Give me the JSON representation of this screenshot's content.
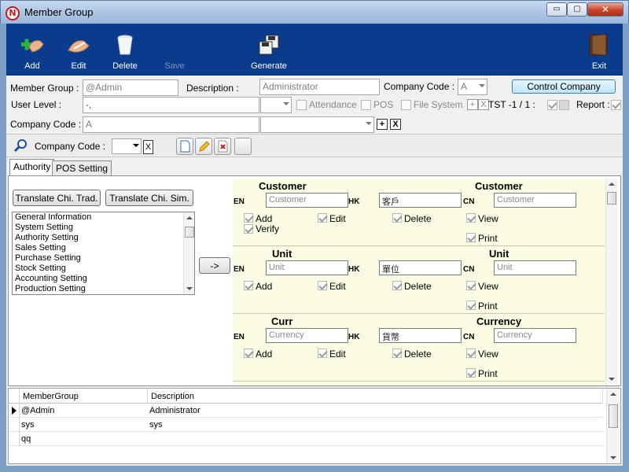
{
  "window": {
    "title": "Member Group",
    "min": "▭",
    "max": "▢",
    "close": "✕"
  },
  "toolbar": {
    "add": "Add",
    "edit": "Edit",
    "delete": "Delete",
    "save": "Save",
    "generate": "Generate",
    "exit": "Exit"
  },
  "form": {
    "member_group_label": "Member Group :",
    "member_group_value": "@Admin",
    "description_label": "Description :",
    "description_value": "Administrator",
    "company_code_label": "Company Code :",
    "company_code_value": "A",
    "control_company_button": "Control Company",
    "user_level_label": "User Level :",
    "user_level_value": "-,",
    "attendance_label": "Attendance",
    "pos_label": "POS",
    "file_system_label": "File System",
    "plus": "+",
    "x": "X",
    "tst_label": "TST -1 / 1 :",
    "report_label": "Report :",
    "company_code2_label": "Company Code :",
    "company_code2_value": "A"
  },
  "search": {
    "company_code_label": "Company Code :",
    "clear": "X"
  },
  "tabs": [
    {
      "label": "Authority"
    },
    {
      "label": "POS Setting"
    }
  ],
  "authority": {
    "translate_trad": "Translate Chi. Trad.",
    "translate_sim": "Translate Chi. Sim.",
    "move_button": "->",
    "settings": [
      "General Information",
      "System Setting",
      "Authority Setting",
      "Sales Setting",
      "Purchase Setting",
      "Stock Setting",
      "Accounting Setting",
      "Production Setting"
    ],
    "sections": [
      {
        "title_left": "Customer",
        "title_right": "Customer",
        "en": "Customer",
        "hk": "客戶",
        "cn": "Customer",
        "perms": [
          "Add",
          "Edit",
          "Delete",
          "View",
          "Verify",
          "Print"
        ]
      },
      {
        "title_left": "Unit",
        "title_right": "Unit",
        "en": "Unit",
        "hk": "單位",
        "cn": "Unit",
        "perms": [
          "Add",
          "Edit",
          "Delete",
          "View",
          "Print"
        ]
      },
      {
        "title_left": "Curr",
        "title_right": "Currency",
        "en": "Currency",
        "hk": "貨幣",
        "cn": "Currency",
        "perms": [
          "Add",
          "Edit",
          "Delete",
          "View",
          "Print"
        ]
      }
    ],
    "lang_en": "EN",
    "lang_hk": "HK",
    "lang_cn": "CN"
  },
  "grid": {
    "columns": [
      "MemberGroup",
      "Description"
    ],
    "rows": [
      {
        "group": "@Admin",
        "description": "Administrator"
      },
      {
        "group": "sys",
        "description": "sys"
      },
      {
        "group": "qq",
        "description": ""
      }
    ]
  }
}
